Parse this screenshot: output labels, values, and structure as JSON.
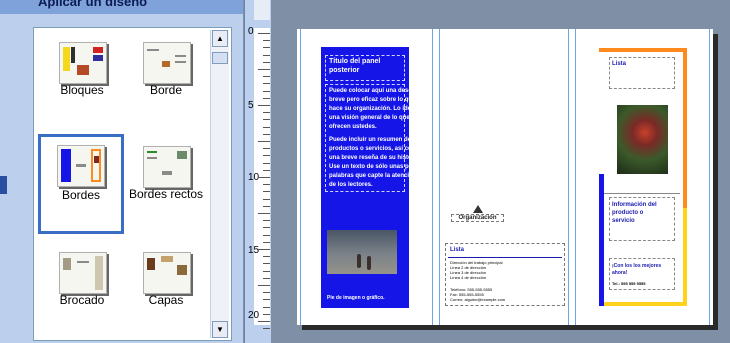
{
  "task_pane": {
    "title": "Aplicar un diseño",
    "designs": [
      {
        "label": "Bloques",
        "selected": false
      },
      {
        "label": "Borde",
        "selected": false
      },
      {
        "label": "Bordes",
        "selected": true
      },
      {
        "label": "Bordes rectos",
        "selected": false
      },
      {
        "label": "Brocado",
        "selected": false
      },
      {
        "label": "Capas",
        "selected": false
      }
    ]
  },
  "scrollbar": {
    "up_glyph": "▲",
    "down_glyph": "▼"
  },
  "ruler": {
    "labels": [
      "0",
      "5",
      "10",
      "15",
      "20"
    ]
  },
  "document": {
    "left_panel": {
      "title_line1": "Título del panel",
      "title_line2": "posterior",
      "body_lines": [
        "Puede colocar aquí una descripción",
        "breve pero eficaz sobre lo que",
        "hace su organización. Lo ideal es",
        "una visión general de lo que",
        "ofrecen ustedes.",
        "Puede incluir un resumen de los",
        "productos o servicios, así como",
        "una breve reseña de su historia.",
        "Use un texto de sólo unas pocas",
        "palabras que capte la atención",
        "de los lectores."
      ],
      "photo_caption": "Pie de imagen o gráfico."
    },
    "middle_panel": {
      "logo_text": "Organización",
      "address_title": "Lista",
      "address_lines": [
        "Dirección del trabajo principal",
        "Línea 2 de dirección",
        "Línea 3 de dirección",
        "Línea 4 de dirección"
      ],
      "contact_lines": [
        "Teléfono: 555-555-5555",
        "Fax: 555-555-5555",
        "Correo: alguien@example.com"
      ]
    },
    "right_panel": {
      "top_label": "Lista",
      "info_line1": "Información del",
      "info_line2": "producto o",
      "info_line3": "servicio",
      "contact_line1": "¡Con los los mejores",
      "contact_line2": "ahora!",
      "phone_line": "Tel.: 555 555 5555"
    }
  },
  "colors": {
    "accent_blue": "#1515e8",
    "accent_orange": "#ff8a1e",
    "accent_yellow": "#ffd21e",
    "selection_border": "#3a6dc4"
  }
}
